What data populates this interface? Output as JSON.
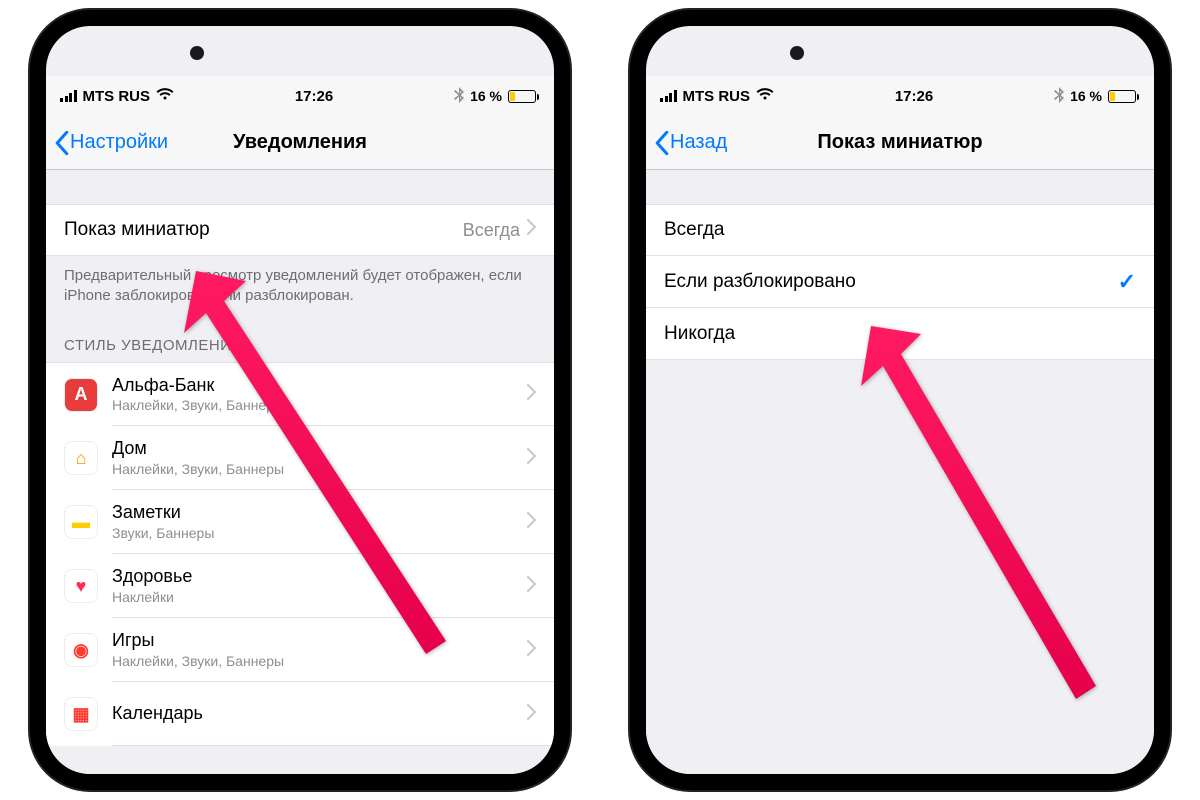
{
  "status": {
    "carrier": "MTS RUS",
    "time": "17:26",
    "battery_pct": "16 %",
    "bt_glyph": "⚡"
  },
  "left": {
    "back_label": "Настройки",
    "title": "Уведомления",
    "preview_row": {
      "label": "Показ миниатюр",
      "value": "Всегда"
    },
    "footer": "Предварительный просмотр уведомлений будет отображен, если iPhone заблокирован или разблокирован.",
    "section_header": "СТИЛЬ УВЕДОМЛЕНИЙ",
    "apps": [
      {
        "name": "Альфа-Банк",
        "sub": "Наклейки, Звуки, Баннеры",
        "icon_bg": "#e83c3c",
        "icon_text": "А",
        "icon_color": "#fff"
      },
      {
        "name": "Дом",
        "sub": "Наклейки, Звуки, Баннеры",
        "icon_bg": "#ffffff",
        "icon_text": "⌂",
        "icon_color": "#ff9500"
      },
      {
        "name": "Заметки",
        "sub": "Звуки, Баннеры",
        "icon_bg": "#ffffff",
        "icon_text": "▬",
        "icon_color": "#ffcc00"
      },
      {
        "name": "Здоровье",
        "sub": "Наклейки",
        "icon_bg": "#ffffff",
        "icon_text": "♥",
        "icon_color": "#ff2d55"
      },
      {
        "name": "Игры",
        "sub": "Наклейки, Звуки, Баннеры",
        "icon_bg": "#ffffff",
        "icon_text": "◉",
        "icon_color": "#ff3b30"
      },
      {
        "name": "Календарь",
        "sub": "",
        "icon_bg": "#ffffff",
        "icon_text": "▦",
        "icon_color": "#ff3b30"
      }
    ]
  },
  "right": {
    "back_label": "Назад",
    "title": "Показ миниатюр",
    "options": [
      {
        "label": "Всегда",
        "selected": false
      },
      {
        "label": "Если разблокировано",
        "selected": true
      },
      {
        "label": "Никогда",
        "selected": false
      }
    ]
  }
}
